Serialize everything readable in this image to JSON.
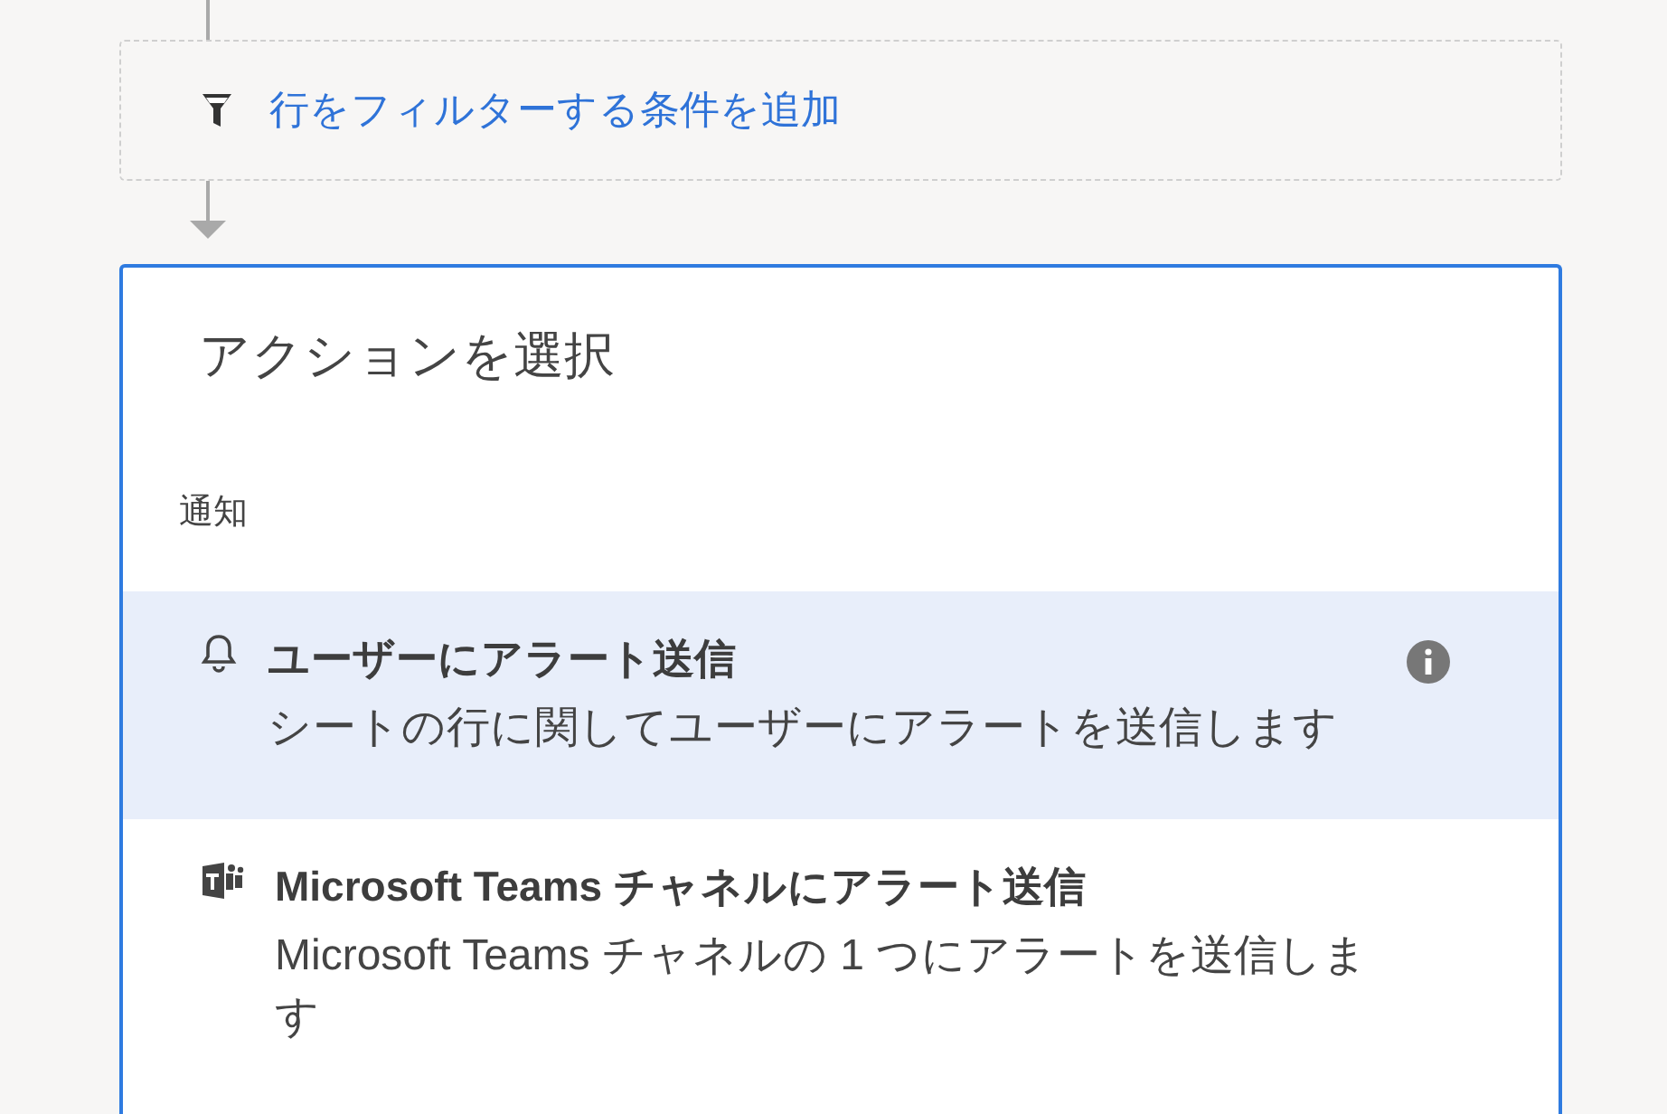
{
  "filter_step": {
    "label": "行をフィルターする条件を追加"
  },
  "action_panel": {
    "title": "アクションを選択",
    "sections": [
      {
        "heading": "通知",
        "items": [
          {
            "kind": "bell",
            "title": "ユーザーにアラート送信",
            "description": "シートの行に関してユーザーにアラートを送信します",
            "selected": true
          },
          {
            "kind": "teams",
            "title": "Microsoft Teams チャネルにアラート送信",
            "description": "Microsoft Teams チャネルの 1 つにアラートを送信します",
            "selected": false
          }
        ]
      }
    ]
  }
}
